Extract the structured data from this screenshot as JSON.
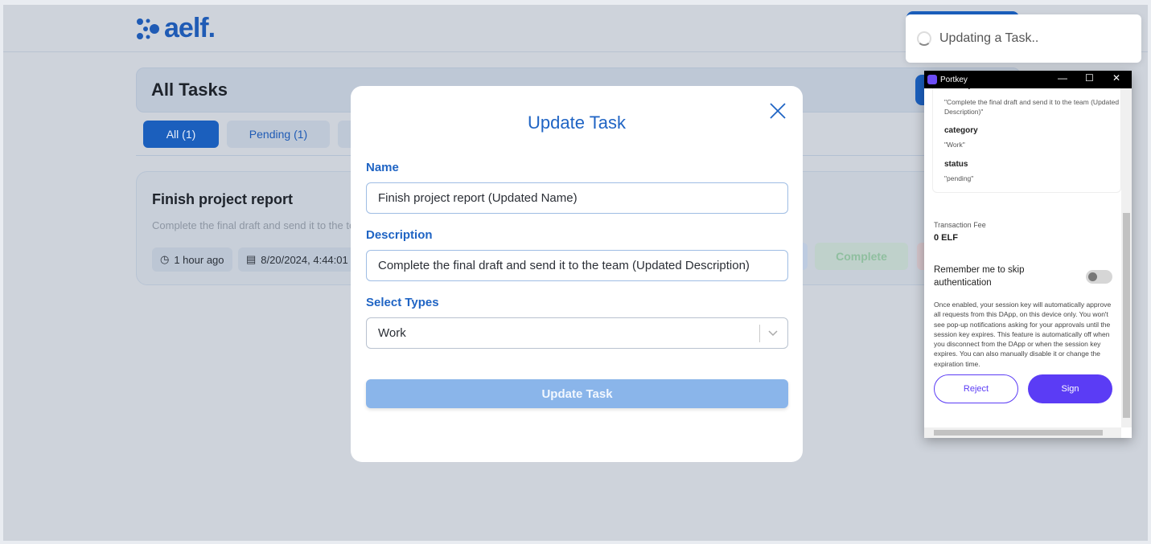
{
  "app": {
    "logo_text": "aelf."
  },
  "tasks": {
    "title": "All Tasks",
    "tabs": [
      {
        "label": "All (1)",
        "active": true
      },
      {
        "label": "Pending (1)",
        "active": false
      },
      {
        "label": "",
        "active": false
      }
    ],
    "card": {
      "name": "Finish project report",
      "description": "Complete the final draft and send it to the team (Updated Description)",
      "time_ago": "1 hour ago",
      "date": "8/20/2024, 4:44:01 PM",
      "complete_label": "Complete"
    }
  },
  "modal": {
    "title": "Update Task",
    "name_label": "Name",
    "name_value": "Finish project report (Updated Name)",
    "description_label": "Description",
    "description_value": "Complete the final draft and send it to the team (Updated Description)",
    "types_label": "Select Types",
    "types_value": "Work",
    "submit_label": "Update Task"
  },
  "toast": {
    "message": "Updating a Task.."
  },
  "portkey": {
    "window_title": "Portkey",
    "desc_key": "description",
    "desc_value": "\"Complete the final draft and send it to the team (Updated Description)\"",
    "category_key": "category",
    "category_value": "\"Work\"",
    "status_key": "status",
    "status_value": "\"pending\"",
    "fee_label": "Transaction Fee",
    "fee_value": "0 ELF",
    "remember_label": "Remember me to skip authentication",
    "remember_enabled": false,
    "info": "Once enabled, your session key will automatically approve all requests from this DApp, on this device only. You won't see pop-up notifications asking for your approvals until the session key expires. This feature is automatically off when you disconnect from the DApp or when the session key expires. You can also manually disable it or change the expiration time.",
    "reject_label": "Reject",
    "sign_label": "Sign",
    "accent": "#5b3cf5"
  }
}
